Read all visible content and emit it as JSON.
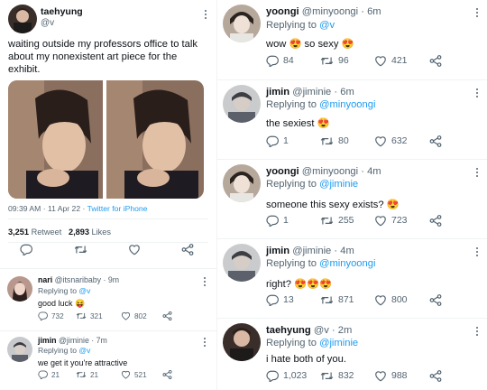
{
  "colors": {
    "accent": "#1d9bf0",
    "muted": "#536471",
    "divider": "#eff3f4"
  },
  "main_tweet": {
    "display_name": "taehyung",
    "handle": "@v",
    "text": "waiting outside my professors office to talk about my nonexistent art piece for the exhibit.",
    "meta_time": "09:39 AM · 11 Apr 22 · ",
    "meta_source": "Twitter for iPhone",
    "retweet_count": "3,251",
    "retweet_label": "Retweet",
    "like_count": "2,893",
    "like_label": "Likes"
  },
  "left_replies": [
    {
      "name": "nari",
      "handle": "@itsnaribaby · 9m",
      "replying_to": "Replying to ",
      "reply_target": "@v",
      "text": "good luck 😝",
      "replies": "732",
      "retweets": "321",
      "likes": "802"
    },
    {
      "name": "jimin",
      "handle": "@jiminie · 7m",
      "replying_to": "Replying to ",
      "reply_target": "@v",
      "text": "we get it you're attractive",
      "replies": "21",
      "retweets": "21",
      "likes": "521"
    }
  ],
  "right_replies": [
    {
      "name": "yoongi",
      "handle": "@minyoongi · 6m",
      "replying_to": "Replying to ",
      "reply_target": "@v",
      "text": "wow 😍 so sexy 😍",
      "replies": "84",
      "retweets": "96",
      "likes": "421"
    },
    {
      "name": "jimin",
      "handle": "@jiminie · 6m",
      "replying_to": "Replying to ",
      "reply_target": "@minyoongi",
      "text": "the sexiest 😍",
      "replies": "1",
      "retweets": "80",
      "likes": "632"
    },
    {
      "name": "yoongi",
      "handle": "@minyoongi · 4m",
      "replying_to": "Replying to ",
      "reply_target": "@jiminie",
      "text": "someone this sexy exists? 😍",
      "replies": "1",
      "retweets": "255",
      "likes": "723"
    },
    {
      "name": "jimin",
      "handle": "@jiminie · 4m",
      "replying_to": "Replying to ",
      "reply_target": "@minyoongi",
      "text": "right? 😍😍😍",
      "replies": "13",
      "retweets": "871",
      "likes": "800"
    },
    {
      "name": "taehyung",
      "handle": "@v · 2m",
      "replying_to": "Replying to ",
      "reply_target": "@jiminie",
      "text": "i hate both of you.",
      "replies": "1,023",
      "retweets": "832",
      "likes": "988"
    }
  ],
  "icons": {
    "reply": "reply-icon",
    "retweet": "retweet-icon",
    "like": "heart-icon",
    "share": "share-icon",
    "more": "more-icon"
  }
}
